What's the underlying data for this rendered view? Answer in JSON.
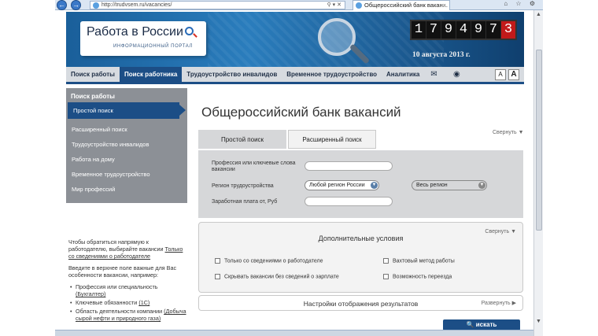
{
  "browser": {
    "back": "←",
    "forward": "→",
    "url": "http://trudvsem.ru/vacancies/",
    "addr_icons": "⚲ ▾ ✕",
    "tab_title": "Общероссийский банк вакан...",
    "tab_close": "×",
    "right_icons": "⌂ ☆ ⚙"
  },
  "header": {
    "logo_name": "Работа в России",
    "logo_sub": "ИНФОРМАЦИОННЫЙ ПОРТАЛ",
    "counter_digits": [
      "1",
      "7",
      "9",
      "4",
      "9",
      "7",
      "3"
    ],
    "date": "10 августа 2013 г."
  },
  "topnav": {
    "items": [
      "Поиск работы",
      "Поиск работника",
      "Трудоустройство инвалидов",
      "Временное трудоустройство",
      "Аналитика"
    ],
    "mail_icon": "✉",
    "eye_icon": "◉",
    "font_small": "A",
    "font_big": "A"
  },
  "sidebar": {
    "title": "Поиск работы",
    "items": [
      "Простой поиск",
      "Расширенный поиск",
      "Трудоустройство инвалидов",
      "Работа на дому",
      "Временное трудоустройство",
      "Мир профессий"
    ]
  },
  "hint": {
    "p1_a": "Чтобы обратиться напрямую к работодателю, выбирайте вакансии",
    "p1_link": "Только со сведениями о работодателе",
    "p2": "Введите в верхнее поле важные для Вас особенности вакансии, например:",
    "items": [
      {
        "text": "Профессия или специальность",
        "example": "(Бухгалтер)"
      },
      {
        "text": "Ключевые обязанности",
        "example": "(1С)"
      },
      {
        "text": "Область деятельности компании",
        "example": "(Добыча сырой нефти и природного газа)"
      }
    ]
  },
  "main": {
    "title": "Общероссийский банк вакансий",
    "tabs": [
      "Простой поиск",
      "Расширенный поиск"
    ],
    "collapse_label": "Свернуть ▼",
    "fields": {
      "profession_label": "Профессия или ключевые слова вакансии",
      "profession_value": "",
      "region_label": "Регион трудоустройства",
      "region_value": "Любой регион России",
      "region2_value": "Весь регион",
      "salary_label": "Заработная плата от, Руб",
      "salary_value": ""
    },
    "additional": {
      "title": "Дополнительные условия",
      "collapse_label": "Свернуть ▼",
      "checkboxes": [
        "Только со сведениями о работодателе",
        "Вахтовый метод работы",
        "Скрывать вакансии без сведений о зарплате",
        "Возможность переезда"
      ]
    },
    "settings": {
      "title": "Настройки отображения результатов",
      "expand_label": "Развернуть ▶"
    },
    "search_button": "🔍 искать"
  }
}
